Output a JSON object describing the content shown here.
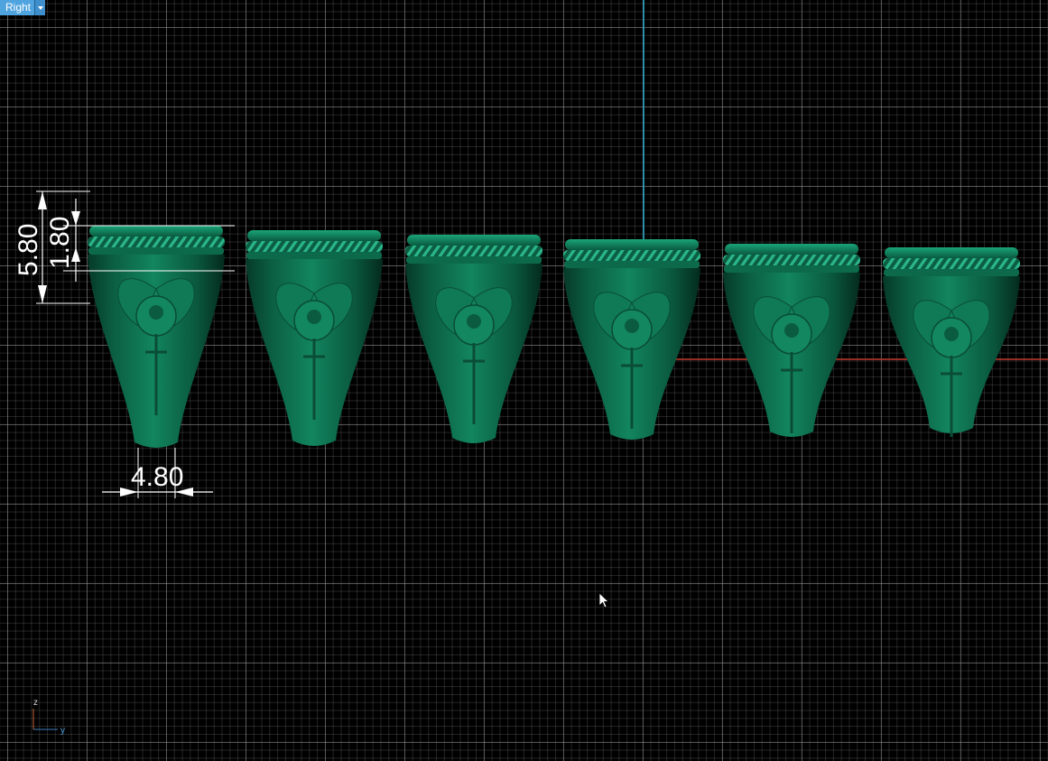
{
  "viewport": {
    "view_name": "Right",
    "colors": {
      "background": "#000000",
      "grid": "#8a8a8a",
      "z_axis": "#2aa8c8",
      "y_axis": "#c23b2b",
      "ring_material": "#0e6a4c",
      "dimension": "#ffffff"
    }
  },
  "dimensions": {
    "height_total": "5.80",
    "band_height": "1.80",
    "bottom_width": "4.80"
  },
  "rings": {
    "count": 6,
    "icon": "signet-ring-model"
  },
  "axis_indicator": {
    "vertical_label": "z",
    "horizontal_label": "y"
  },
  "cursor": {
    "icon": "arrow-cursor"
  }
}
